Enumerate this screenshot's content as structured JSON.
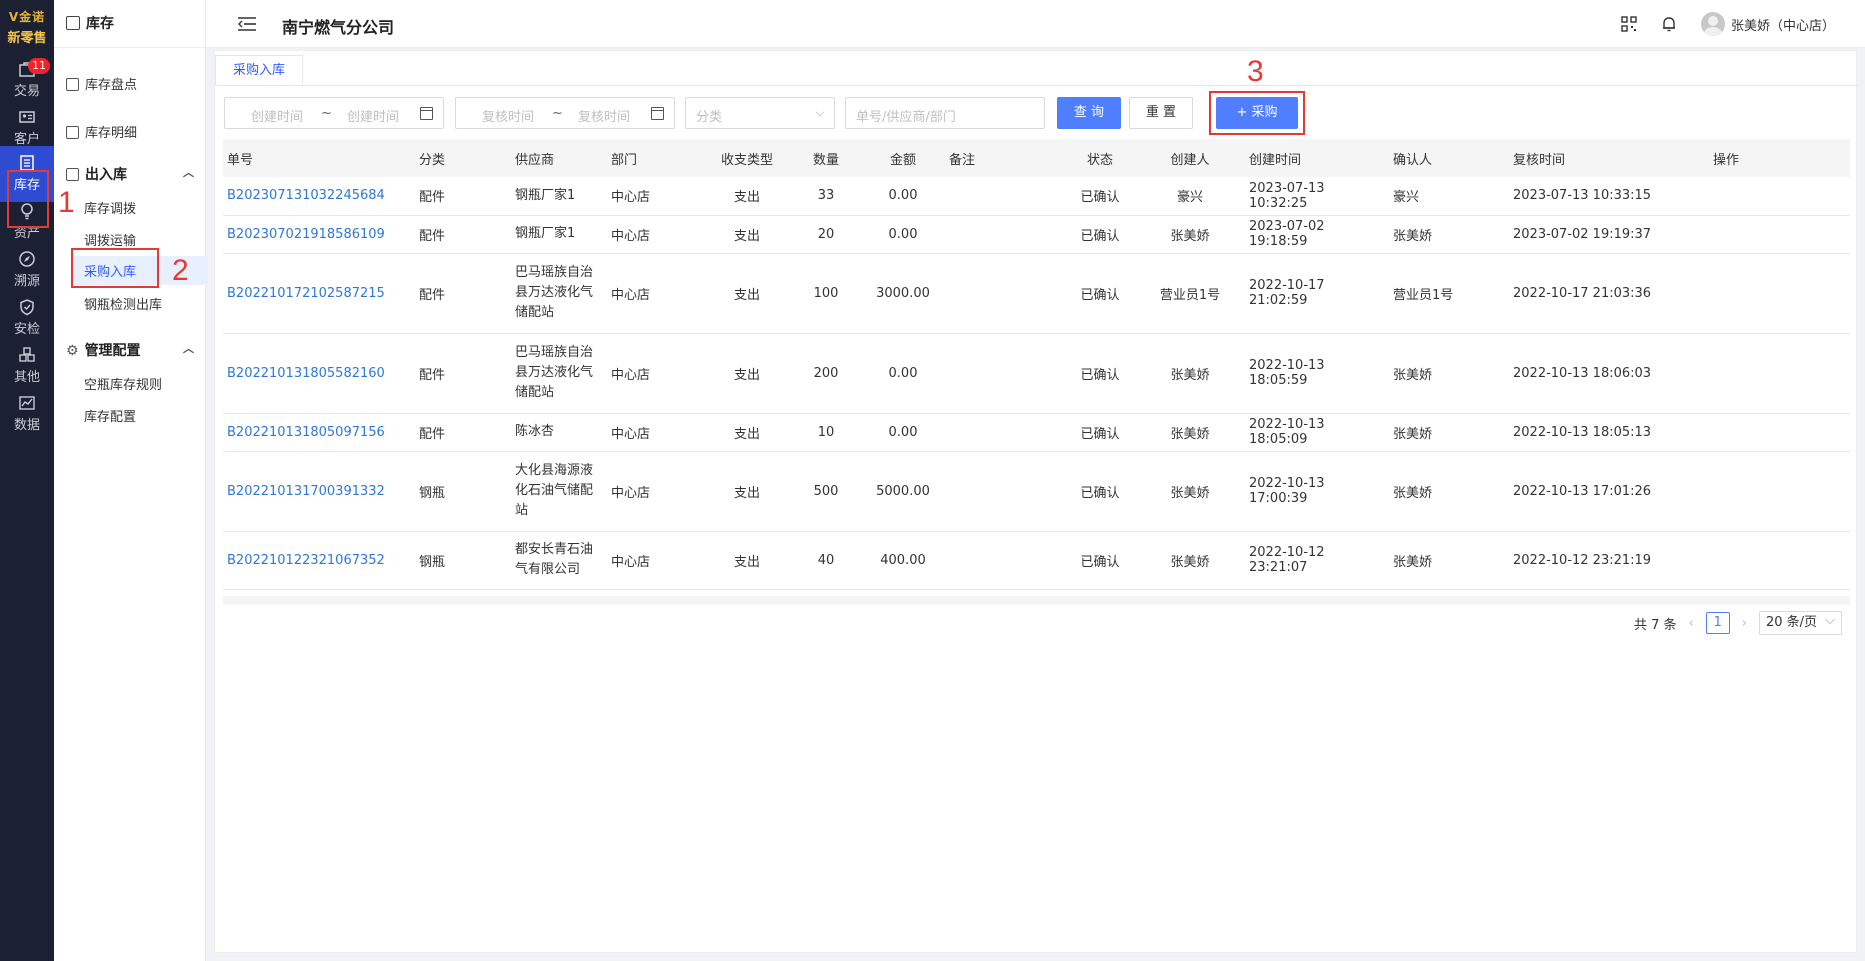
{
  "brand": {
    "line1": "V金诺",
    "line2": "新零售"
  },
  "rail": [
    {
      "label": "交易",
      "icon": "bag-icon",
      "badge": "11"
    },
    {
      "label": "客户",
      "icon": "id-card-icon"
    },
    {
      "label": "库存",
      "icon": "inventory-icon",
      "active": true
    },
    {
      "label": "资产",
      "icon": "bulb-icon"
    },
    {
      "label": "溯源",
      "icon": "compass-icon"
    },
    {
      "label": "安检",
      "icon": "shield-icon"
    },
    {
      "label": "其他",
      "icon": "apps-icon"
    },
    {
      "label": "数据",
      "icon": "chart-icon"
    }
  ],
  "sidebar": {
    "title": "库存",
    "links": [
      "库存盘点",
      "库存明细"
    ],
    "group1": {
      "title": "出入库",
      "items": [
        "库存调拨",
        "调拨运输",
        "采购入库",
        "钢瓶检测出库"
      ]
    },
    "group2": {
      "title": "管理配置",
      "items": [
        "空瓶库存规则",
        "库存配置"
      ]
    }
  },
  "header": {
    "company": "南宁燃气分公司",
    "user": "张美娇（中心店）"
  },
  "tab": "采购入库",
  "filters": {
    "create_start": "创建时间",
    "create_end": "创建时间",
    "sep": "~",
    "review_start": "复核时间",
    "review_end": "复核时间",
    "category": "分类",
    "search": "单号/供应商/部门"
  },
  "buttons": {
    "query": "查 询",
    "reset": "重 置",
    "purchase": "+ 采购"
  },
  "annotations": [
    "1",
    "2",
    "3"
  ],
  "table": {
    "headers": [
      "单号",
      "分类",
      "供应商",
      "部门",
      "收支类型",
      "数量",
      "金额",
      "备注",
      "状态",
      "创建人",
      "创建时间",
      "确认人",
      "复核时间",
      "操作"
    ],
    "rows": [
      {
        "id": "B202307131032245684",
        "cat": "配件",
        "sup": "钢瓶厂家1",
        "dept": "中心店",
        "type": "支出",
        "qty": "33",
        "amt": "0.00",
        "note": "",
        "status": "已确认",
        "creator": "豪兴",
        "ctime": "2023-07-13 10:32:25",
        "confirmer": "豪兴",
        "rtime": "2023-07-13 10:33:15"
      },
      {
        "id": "B202307021918586109",
        "cat": "配件",
        "sup": "钢瓶厂家1",
        "dept": "中心店",
        "type": "支出",
        "qty": "20",
        "amt": "0.00",
        "note": "",
        "status": "已确认",
        "creator": "张美娇",
        "ctime": "2023-07-02 19:18:59",
        "confirmer": "张美娇",
        "rtime": "2023-07-02 19:19:37"
      },
      {
        "id": "B202210172102587215",
        "cat": "配件",
        "sup": "巴马瑶族自治县万达液化气储配站",
        "dept": "中心店",
        "type": "支出",
        "qty": "100",
        "amt": "3000.00",
        "note": "",
        "status": "已确认",
        "creator": "营业员1号",
        "ctime": "2022-10-17 21:02:59",
        "confirmer": "营业员1号",
        "rtime": "2022-10-17 21:03:36"
      },
      {
        "id": "B202210131805582160",
        "cat": "配件",
        "sup": "巴马瑶族自治县万达液化气储配站",
        "dept": "中心店",
        "type": "支出",
        "qty": "200",
        "amt": "0.00",
        "note": "",
        "status": "已确认",
        "creator": "张美娇",
        "ctime": "2022-10-13 18:05:59",
        "confirmer": "张美娇",
        "rtime": "2022-10-13 18:06:03"
      },
      {
        "id": "B202210131805097156",
        "cat": "配件",
        "sup": "陈冰杏",
        "dept": "中心店",
        "type": "支出",
        "qty": "10",
        "amt": "0.00",
        "note": "",
        "status": "已确认",
        "creator": "张美娇",
        "ctime": "2022-10-13 18:05:09",
        "confirmer": "张美娇",
        "rtime": "2022-10-13 18:05:13"
      },
      {
        "id": "B202210131700391332",
        "cat": "钢瓶",
        "sup": "大化县海源液化石油气储配站",
        "dept": "中心店",
        "type": "支出",
        "qty": "500",
        "amt": "5000.00",
        "note": "",
        "status": "已确认",
        "creator": "张美娇",
        "ctime": "2022-10-13 17:00:39",
        "confirmer": "张美娇",
        "rtime": "2022-10-13 17:01:26"
      },
      {
        "id": "B202210122321067352",
        "cat": "钢瓶",
        "sup": "都安长青石油气有限公司",
        "dept": "中心店",
        "type": "支出",
        "qty": "40",
        "amt": "400.00",
        "note": "",
        "status": "已确认",
        "creator": "张美娇",
        "ctime": "2022-10-12 23:21:07",
        "confirmer": "张美娇",
        "rtime": "2022-10-12 23:21:19"
      }
    ]
  },
  "pagination": {
    "total": "共 7 条",
    "prev": "‹",
    "current": "1",
    "next": "›",
    "size": "20 条/页"
  }
}
